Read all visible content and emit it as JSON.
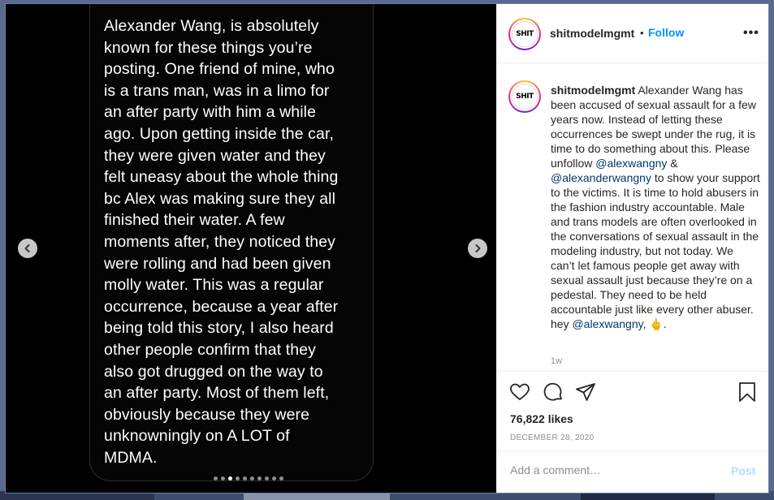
{
  "post": {
    "slide_text": "Alexander Wang, is absolutely\nknown for these things you’re\nposting. One friend of mine, who\nis a trans man, was in a limo for\nan after party with him a while\nago. Upon getting inside the car,\nthey were given water and they\nfelt uneasy about the whole thing\nbc Alex was making sure they all\nfinished their water. A few\nmoments after, they noticed they\nwere rolling and had been given\nmolly water. This was a regular\noccurrence, because a year after\nbeing told this story, I also heard\nother people confirm that they\nalso got drugged on the way to\nan after party. Most of them left,\nobviously because they were\nunknowningly on A LOT of\nMDMA.",
    "carousel": {
      "total": 10,
      "active_index": 2
    }
  },
  "header": {
    "avatar_logo": "SHIT",
    "username": "shitmodelmgmt",
    "separator": "•",
    "follow_label": "Follow",
    "more_label": "•••"
  },
  "caption": {
    "avatar_logo": "SHIT",
    "username": "shitmodelmgmt",
    "text_1": " Alexander Wang has been accused of sexual assault for a few years now. Instead of letting these occurrences be swept under the rug, it is time to do something about this. Please unfollow ",
    "mention_1": "@alexwangny",
    "text_2": " & ",
    "mention_2": "@alexanderwangny",
    "text_3": " to show your support to the victims. It is time to hold abusers in the fashion industry accountable. Male and trans models are often overlooked in the conversations of sexual assault in the modeling industry, but not today. We can’t let famous people get away with sexual assault just because they’re on a pedestal. They need to be held accountable just like every other abuser. hey ",
    "mention_3": "@alexwangny",
    "text_4": ", 🖕.",
    "time_ago": "1w"
  },
  "actions": {
    "likes": "76,822 likes",
    "date": "DECEMBER 28, 2020"
  },
  "comment": {
    "placeholder": "Add a comment…",
    "post_label": "Post"
  },
  "colors": {
    "accent": "#0095f6",
    "mention": "#00376b",
    "post_disabled": "#b2dffc"
  }
}
